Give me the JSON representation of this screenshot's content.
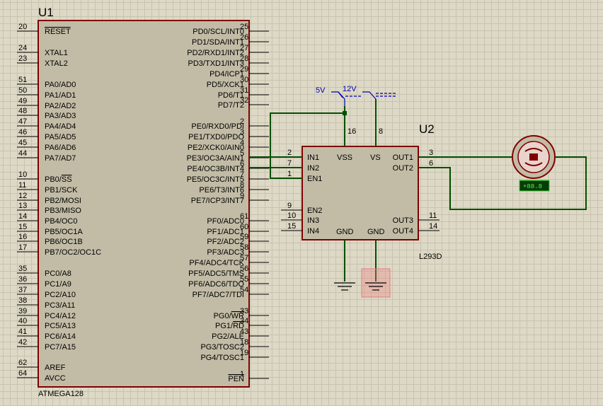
{
  "u1": {
    "ref": "U1",
    "part": "ATMEGA128",
    "left_pins": [
      {
        "num": "20",
        "name": "RESET",
        "overline": "RESET"
      },
      {
        "num": "24",
        "name": "XTAL1"
      },
      {
        "num": "23",
        "name": "XTAL2"
      },
      {
        "num": "51",
        "name": "PA0/AD0"
      },
      {
        "num": "50",
        "name": "PA1/AD1"
      },
      {
        "num": "49",
        "name": "PA2/AD2"
      },
      {
        "num": "48",
        "name": "PA3/AD3"
      },
      {
        "num": "47",
        "name": "PA4/AD4"
      },
      {
        "num": "46",
        "name": "PA5/AD5"
      },
      {
        "num": "45",
        "name": "PA6/AD6"
      },
      {
        "num": "44",
        "name": "PA7/AD7"
      },
      {
        "num": "10",
        "name": "PB0/SS",
        "pre": "PB0/",
        "overline": "SS"
      },
      {
        "num": "11",
        "name": "PB1/SCK"
      },
      {
        "num": "12",
        "name": "PB2/MOSI"
      },
      {
        "num": "13",
        "name": "PB3/MISO"
      },
      {
        "num": "14",
        "name": "PB4/OC0"
      },
      {
        "num": "15",
        "name": "PB5/OC1A"
      },
      {
        "num": "16",
        "name": "PB6/OC1B"
      },
      {
        "num": "17",
        "name": "PB7/OC2/OC1C"
      },
      {
        "num": "35",
        "name": "PC0/A8"
      },
      {
        "num": "36",
        "name": "PC1/A9"
      },
      {
        "num": "37",
        "name": "PC2/A10"
      },
      {
        "num": "38",
        "name": "PC3/A11"
      },
      {
        "num": "39",
        "name": "PC4/A12"
      },
      {
        "num": "40",
        "name": "PC5/A13"
      },
      {
        "num": "41",
        "name": "PC6/A14"
      },
      {
        "num": "42",
        "name": "PC7/A15"
      },
      {
        "num": "62",
        "name": "AREF"
      },
      {
        "num": "64",
        "name": "AVCC"
      }
    ],
    "right_pins": [
      {
        "num": "25",
        "name": "PD0/SCL/INT0"
      },
      {
        "num": "26",
        "name": "PD1/SDA/INT1"
      },
      {
        "num": "27",
        "name": "PD2/RXD1/INT2"
      },
      {
        "num": "28",
        "name": "PD3/TXD1/INT3"
      },
      {
        "num": "29",
        "name": "PD4/ICP1"
      },
      {
        "num": "30",
        "name": "PD5/XCK1"
      },
      {
        "num": "31",
        "name": "PD6/T1"
      },
      {
        "num": "32",
        "name": "PD7/T2"
      },
      {
        "num": "2",
        "name": "PE0/RXD0/PDI"
      },
      {
        "num": "3",
        "name": "PE1/TXD0/PDO"
      },
      {
        "num": "4",
        "name": "PE2/XCK0/AIN0"
      },
      {
        "num": "5",
        "name": "PE3/OC3A/AIN1"
      },
      {
        "num": "6",
        "name": "PE4/OC3B/INT4"
      },
      {
        "num": "7",
        "name": "PE5/OC3C/INT5"
      },
      {
        "num": "8",
        "name": "PE6/T3/INT6"
      },
      {
        "num": "9",
        "name": "PE7/ICP3/INT7"
      },
      {
        "num": "61",
        "name": "PF0/ADC0"
      },
      {
        "num": "60",
        "name": "PF1/ADC1"
      },
      {
        "num": "59",
        "name": "PF2/ADC2"
      },
      {
        "num": "58",
        "name": "PF3/ADC3"
      },
      {
        "num": "57",
        "name": "PF4/ADC4/TCK"
      },
      {
        "num": "56",
        "name": "PF5/ADC5/TMS"
      },
      {
        "num": "55",
        "name": "PF6/ADC6/TDO"
      },
      {
        "num": "54",
        "name": "PF7/ADC7/TDI"
      },
      {
        "num": "33",
        "name": "PG0/WR",
        "pre": "PG0/",
        "overline": "WR"
      },
      {
        "num": "34",
        "name": "PG1/RD",
        "pre": "PG1/",
        "overline": "RD"
      },
      {
        "num": "43",
        "name": "PG2/ALE"
      },
      {
        "num": "18",
        "name": "PG3/TOSC2"
      },
      {
        "num": "19",
        "name": "PG4/TOSC1"
      },
      {
        "num": "1",
        "name": "PEN",
        "overline": "PEN"
      }
    ]
  },
  "u2": {
    "ref": "U2",
    "part": "L293D",
    "left_pins": [
      {
        "num": "2",
        "name": "IN1"
      },
      {
        "num": "7",
        "name": "IN2"
      },
      {
        "num": "1",
        "name": "EN1"
      },
      {
        "num": "9",
        "name": "EN2"
      },
      {
        "num": "10",
        "name": "IN3"
      },
      {
        "num": "15",
        "name": "IN4"
      }
    ],
    "right_pins": [
      {
        "num": "3",
        "name": "OUT1"
      },
      {
        "num": "6",
        "name": "OUT2"
      },
      {
        "num": "11",
        "name": "OUT3"
      },
      {
        "num": "14",
        "name": "OUT4"
      }
    ],
    "top_pins": [
      {
        "num": "16",
        "name": "VSS"
      },
      {
        "num": "8",
        "name": "VS"
      }
    ],
    "bottom_pins": [
      {
        "name": "GND"
      },
      {
        "name": "GND"
      }
    ]
  },
  "power": [
    {
      "label": "5V"
    },
    {
      "label": "12V"
    }
  ],
  "motor": {
    "readout": "+88.8"
  },
  "colors": {
    "wire": "#005000",
    "body_fill": "#c2bca6",
    "body_stroke": "#800000",
    "power_label": "#0000b4",
    "background": "#ded9c6",
    "selection": "#f08080"
  }
}
